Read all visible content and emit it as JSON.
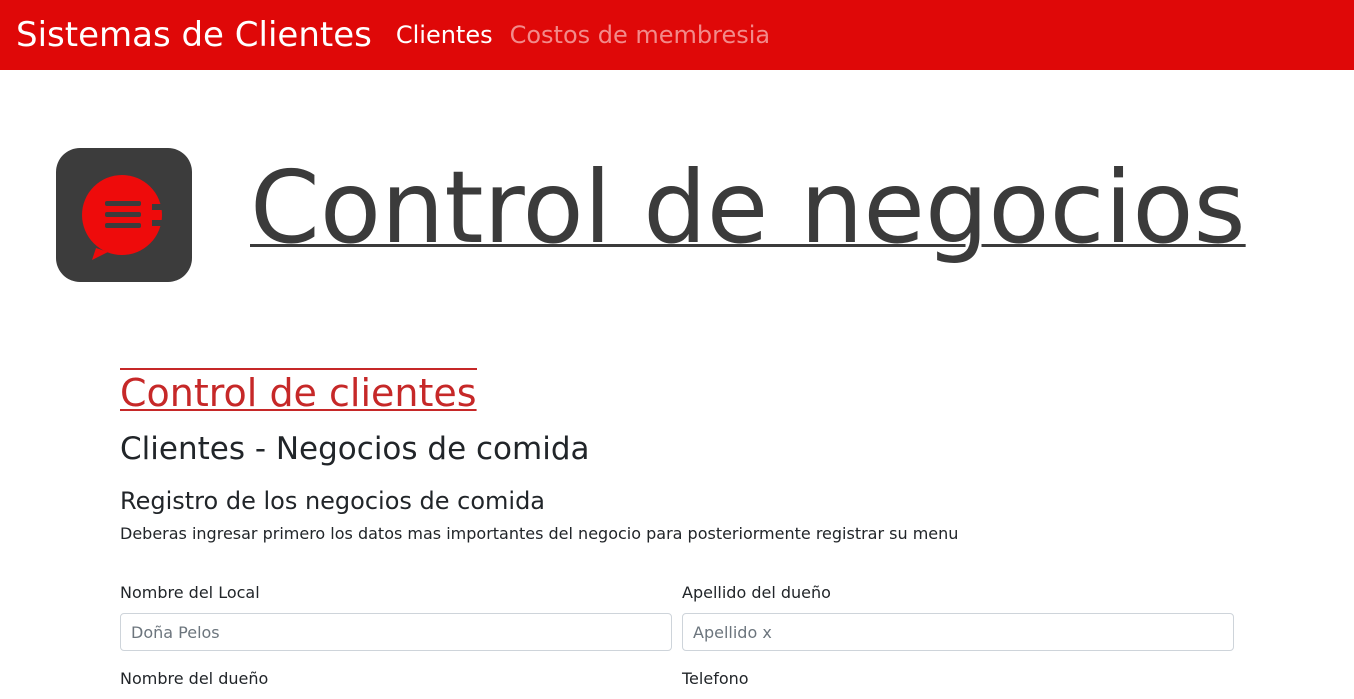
{
  "navbar": {
    "brand": "Sistemas de Clientes",
    "links": [
      {
        "label": "Clientes",
        "active": true
      },
      {
        "label": "Costos de membresia",
        "active": false
      }
    ],
    "background_color": "#df0808"
  },
  "hero": {
    "logo_icon": "chat-fork-logo-icon",
    "title": "Control de negocios"
  },
  "content": {
    "section_link": "Control de clientes",
    "heading": "Clientes - Negocios de comida",
    "subheading": "Registro de los negocios de comida",
    "description": "Deberas ingresar primero los datos mas importantes del negocio para posteriormente registrar su menu"
  },
  "form": {
    "fields": [
      {
        "label": "Nombre del Local",
        "placeholder": "Doña Pelos",
        "value": ""
      },
      {
        "label": "Apellido del dueño",
        "placeholder": "Apellido x",
        "value": ""
      },
      {
        "label": "Nombre del dueño",
        "placeholder": "",
        "value": ""
      },
      {
        "label": "Telefono",
        "placeholder": "",
        "value": ""
      }
    ]
  }
}
